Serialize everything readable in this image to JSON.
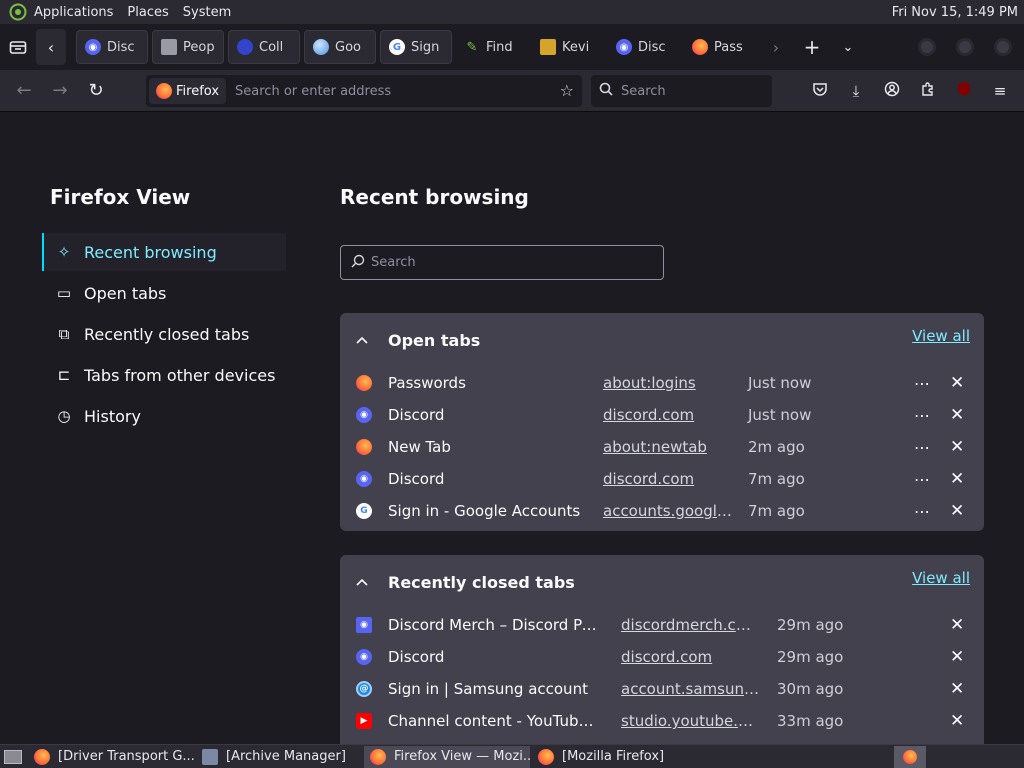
{
  "top_panel": {
    "menus": [
      "Applications",
      "Places",
      "System"
    ],
    "clock": "Fri Nov 15, 1:49 PM"
  },
  "tabs": [
    {
      "label": "Disc",
      "icon": "discord-icon",
      "color": "#5865f2",
      "boxed": true
    },
    {
      "label": "Peop",
      "icon": "roblox-icon",
      "color": "#9a9aa6",
      "boxed": true
    },
    {
      "label": "Coll",
      "icon": "collection-icon",
      "color": "#3344cc",
      "boxed": true
    },
    {
      "label": "Goo",
      "icon": "globe-icon",
      "color": "#4a90e2",
      "boxed": true
    },
    {
      "label": "Sign",
      "icon": "google-icon",
      "color": "#ffffff",
      "boxed": true
    },
    {
      "label": "Find",
      "icon": "pencil-icon",
      "color": "#7ac143",
      "boxed": false
    },
    {
      "label": "Kevi",
      "icon": "kevin-icon",
      "color": "#d4a52a",
      "boxed": false
    },
    {
      "label": "Disc",
      "icon": "discord-icon",
      "color": "#5865f2",
      "boxed": false
    },
    {
      "label": "Pass",
      "icon": "firefox-icon",
      "color": "#ff7139",
      "boxed": false
    }
  ],
  "navbar": {
    "identity_label": "Firefox",
    "url_placeholder": "Search or enter address",
    "search_placeholder": "Search"
  },
  "sidebar": {
    "title": "Firefox View",
    "items": [
      {
        "label": "Recent browsing",
        "icon": "sparkle-icon",
        "active": true
      },
      {
        "label": "Open tabs",
        "icon": "tab-window-icon",
        "active": false
      },
      {
        "label": "Recently closed tabs",
        "icon": "closed-tab-icon",
        "active": false
      },
      {
        "label": "Tabs from other devices",
        "icon": "synced-devices-icon",
        "active": false
      },
      {
        "label": "History",
        "icon": "history-clock-icon",
        "active": false
      }
    ]
  },
  "main": {
    "title": "Recent browsing",
    "search_placeholder": "Search",
    "open_tabs": {
      "title": "Open tabs",
      "view_all": "View all",
      "rows": [
        {
          "title": "Passwords",
          "url": "about:logins",
          "time": "Just now",
          "icon": "firefox-icon",
          "color": "#ff7139"
        },
        {
          "title": "Discord",
          "url": "discord.com",
          "time": "Just now",
          "icon": "discord-icon",
          "color": "#5865f2"
        },
        {
          "title": "New Tab",
          "url": "about:newtab",
          "time": "2m ago",
          "icon": "firefox-icon",
          "color": "#ff7139"
        },
        {
          "title": "Discord",
          "url": "discord.com",
          "time": "7m ago",
          "icon": "discord-icon",
          "color": "#5865f2"
        },
        {
          "title": "Sign in - Google Accounts",
          "url": "accounts.google.com",
          "time": "7m ago",
          "icon": "google-icon",
          "color": "#ffffff"
        }
      ]
    },
    "recently_closed": {
      "title": "Recently closed tabs",
      "view_all": "View all",
      "rows": [
        {
          "title": "Discord Merch – Discord Powered",
          "url": "discordmerch.com",
          "time": "29m ago",
          "icon": "discord-merch-icon",
          "color": "#5865f2"
        },
        {
          "title": "Discord",
          "url": "discord.com",
          "time": "29m ago",
          "icon": "discord-icon",
          "color": "#5865f2"
        },
        {
          "title": "Sign in | Samsung account",
          "url": "account.samsung.com",
          "time": "30m ago",
          "icon": "samsung-icon",
          "color": "#1e88e5"
        },
        {
          "title": "Channel content - YouTube Studio",
          "url": "studio.youtube.com",
          "time": "33m ago",
          "icon": "youtube-icon",
          "color": "#ff0000"
        }
      ]
    }
  },
  "taskbar": {
    "tasks": [
      {
        "label": "[Driver Transport G...",
        "icon": "firefox-icon",
        "active": false
      },
      {
        "label": "[Archive Manager]",
        "icon": "archive-manager-icon",
        "active": false
      },
      {
        "label": "Firefox View — Mozi...",
        "icon": "firefox-icon",
        "active": true
      },
      {
        "label": "[Mozilla Firefox]",
        "icon": "firefox-icon",
        "active": false
      }
    ]
  }
}
